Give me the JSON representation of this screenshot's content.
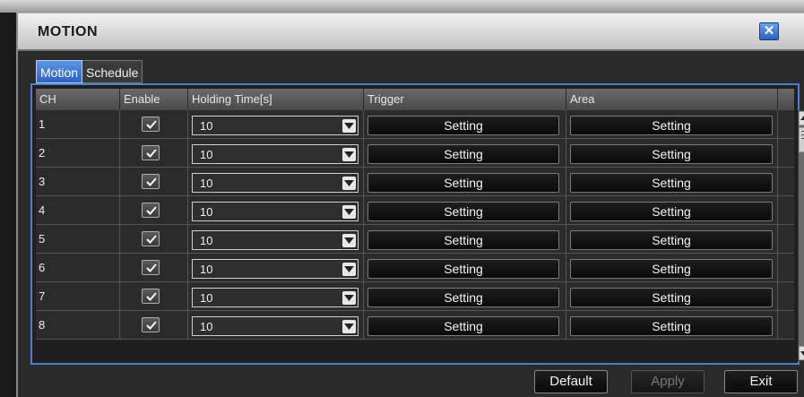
{
  "window": {
    "title": "MOTION",
    "close_symbol": "✕"
  },
  "tabs": [
    {
      "label": "Motion",
      "active": true
    },
    {
      "label": "Schedule",
      "active": false
    }
  ],
  "table": {
    "headers": [
      "CH",
      "Enable",
      "Holding Time[s]",
      "Trigger",
      "Area"
    ],
    "rows": [
      {
        "ch": "1",
        "enabled": true,
        "holding_time": "10",
        "trigger": "Setting",
        "area": "Setting"
      },
      {
        "ch": "2",
        "enabled": true,
        "holding_time": "10",
        "trigger": "Setting",
        "area": "Setting"
      },
      {
        "ch": "3",
        "enabled": true,
        "holding_time": "10",
        "trigger": "Setting",
        "area": "Setting"
      },
      {
        "ch": "4",
        "enabled": true,
        "holding_time": "10",
        "trigger": "Setting",
        "area": "Setting"
      },
      {
        "ch": "5",
        "enabled": true,
        "holding_time": "10",
        "trigger": "Setting",
        "area": "Setting"
      },
      {
        "ch": "6",
        "enabled": true,
        "holding_time": "10",
        "trigger": "Setting",
        "area": "Setting"
      },
      {
        "ch": "7",
        "enabled": true,
        "holding_time": "10",
        "trigger": "Setting",
        "area": "Setting"
      },
      {
        "ch": "8",
        "enabled": true,
        "holding_time": "10",
        "trigger": "Setting",
        "area": "Setting"
      }
    ]
  },
  "buttons": {
    "default": "Default",
    "apply": "Apply",
    "exit": "Exit"
  },
  "icons": [
    "close-icon",
    "checkmark-icon",
    "dropdown-arrow-icon",
    "scroll-up-icon",
    "scroll-down-icon"
  ],
  "colors": {
    "accent": "#2a62c6",
    "panel_border": "#4c7fd0"
  }
}
